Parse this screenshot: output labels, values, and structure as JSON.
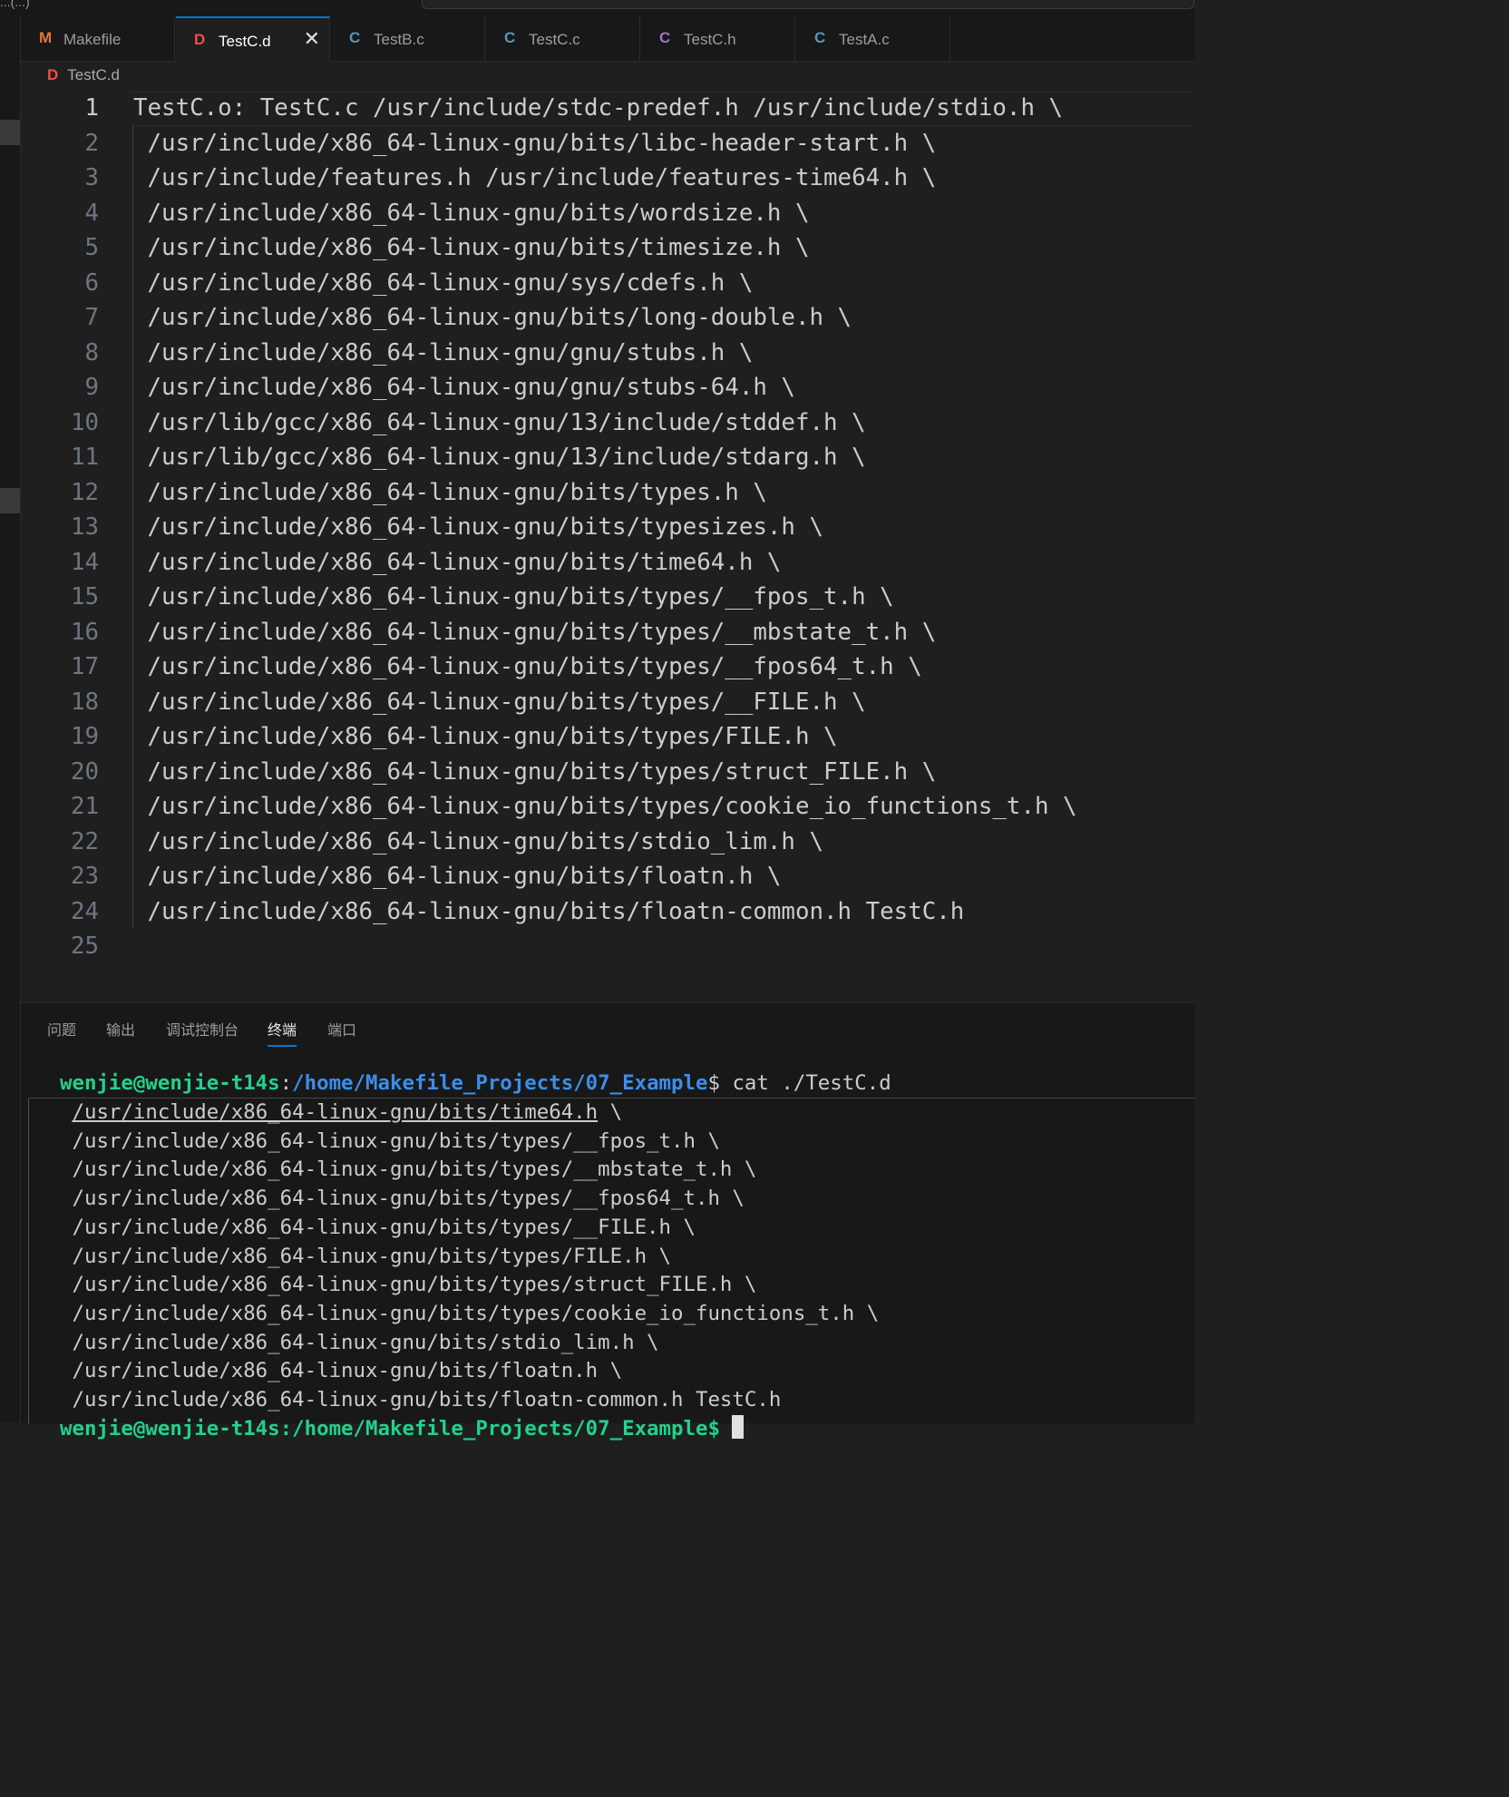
{
  "window": {
    "title_fragment": "...(...)"
  },
  "tabs": [
    {
      "icon": "M",
      "icon_color": "#e37933",
      "label": "Makefile",
      "active": false
    },
    {
      "icon": "D",
      "icon_color": "#f14c4c",
      "label": "TestC.d",
      "active": true,
      "close": "✕"
    },
    {
      "icon": "C",
      "icon_color": "#519aba",
      "label": "TestB.c",
      "active": false
    },
    {
      "icon": "C",
      "icon_color": "#519aba",
      "label": "TestC.c",
      "active": false
    },
    {
      "icon": "C",
      "icon_color": "#a074c4",
      "label": "TestC.h",
      "active": false
    },
    {
      "icon": "C",
      "icon_color": "#519aba",
      "label": "TestA.c",
      "active": false
    }
  ],
  "breadcrumb": {
    "icon": "D",
    "label": "TestC.d"
  },
  "editor": {
    "lines": [
      "TestC.o: TestC.c /usr/include/stdc-predef.h /usr/include/stdio.h \\",
      " /usr/include/x86_64-linux-gnu/bits/libc-header-start.h \\",
      " /usr/include/features.h /usr/include/features-time64.h \\",
      " /usr/include/x86_64-linux-gnu/bits/wordsize.h \\",
      " /usr/include/x86_64-linux-gnu/bits/timesize.h \\",
      " /usr/include/x86_64-linux-gnu/sys/cdefs.h \\",
      " /usr/include/x86_64-linux-gnu/bits/long-double.h \\",
      " /usr/include/x86_64-linux-gnu/gnu/stubs.h \\",
      " /usr/include/x86_64-linux-gnu/gnu/stubs-64.h \\",
      " /usr/lib/gcc/x86_64-linux-gnu/13/include/stddef.h \\",
      " /usr/lib/gcc/x86_64-linux-gnu/13/include/stdarg.h \\",
      " /usr/include/x86_64-linux-gnu/bits/types.h \\",
      " /usr/include/x86_64-linux-gnu/bits/typesizes.h \\",
      " /usr/include/x86_64-linux-gnu/bits/time64.h \\",
      " /usr/include/x86_64-linux-gnu/bits/types/__fpos_t.h \\",
      " /usr/include/x86_64-linux-gnu/bits/types/__mbstate_t.h \\",
      " /usr/include/x86_64-linux-gnu/bits/types/__fpos64_t.h \\",
      " /usr/include/x86_64-linux-gnu/bits/types/__FILE.h \\",
      " /usr/include/x86_64-linux-gnu/bits/types/FILE.h \\",
      " /usr/include/x86_64-linux-gnu/bits/types/struct_FILE.h \\",
      " /usr/include/x86_64-linux-gnu/bits/types/cookie_io_functions_t.h \\",
      " /usr/include/x86_64-linux-gnu/bits/stdio_lim.h \\",
      " /usr/include/x86_64-linux-gnu/bits/floatn.h \\",
      " /usr/include/x86_64-linux-gnu/bits/floatn-common.h TestC.h",
      ""
    ],
    "line_numbers": [
      "1",
      "2",
      "3",
      "4",
      "5",
      "6",
      "7",
      "8",
      "9",
      "10",
      "11",
      "12",
      "13",
      "14",
      "15",
      "16",
      "17",
      "18",
      "19",
      "20",
      "21",
      "22",
      "23",
      "24",
      "25"
    ]
  },
  "panel": {
    "tabs": [
      "问题",
      "输出",
      "调试控制台",
      "终端",
      "端口"
    ],
    "active_tab": "终端"
  },
  "terminal": {
    "prompt_user": "wenjie@wenjie-t14s",
    "prompt_sep": ":",
    "prompt_path": "/home/Makefile_Projects/07_Example",
    "prompt_end": "$",
    "command": " cat ./TestC.d",
    "output": [
      " /usr/include/x86_64-linux-gnu/bits/time64.h \\",
      " /usr/include/x86_64-linux-gnu/bits/types/__fpos_t.h \\",
      " /usr/include/x86_64-linux-gnu/bits/types/__mbstate_t.h \\",
      " /usr/include/x86_64-linux-gnu/bits/types/__fpos64_t.h \\",
      " /usr/include/x86_64-linux-gnu/bits/types/__FILE.h \\",
      " /usr/include/x86_64-linux-gnu/bits/types/FILE.h \\",
      " /usr/include/x86_64-linux-gnu/bits/types/struct_FILE.h \\",
      " /usr/include/x86_64-linux-gnu/bits/types/cookie_io_functions_t.h \\",
      " /usr/include/x86_64-linux-gnu/bits/stdio_lim.h \\",
      " /usr/include/x86_64-linux-gnu/bits/floatn.h \\",
      " /usr/include/x86_64-linux-gnu/bits/floatn-common.h TestC.h"
    ],
    "last_prompt_partial": "wenjie@wenjie-t14s:/home/Makefile_Projects/07_Example$ "
  },
  "colors": {
    "accent": "#0078d4",
    "terminal_user": "#23d18b",
    "terminal_path": "#3b8eea"
  }
}
